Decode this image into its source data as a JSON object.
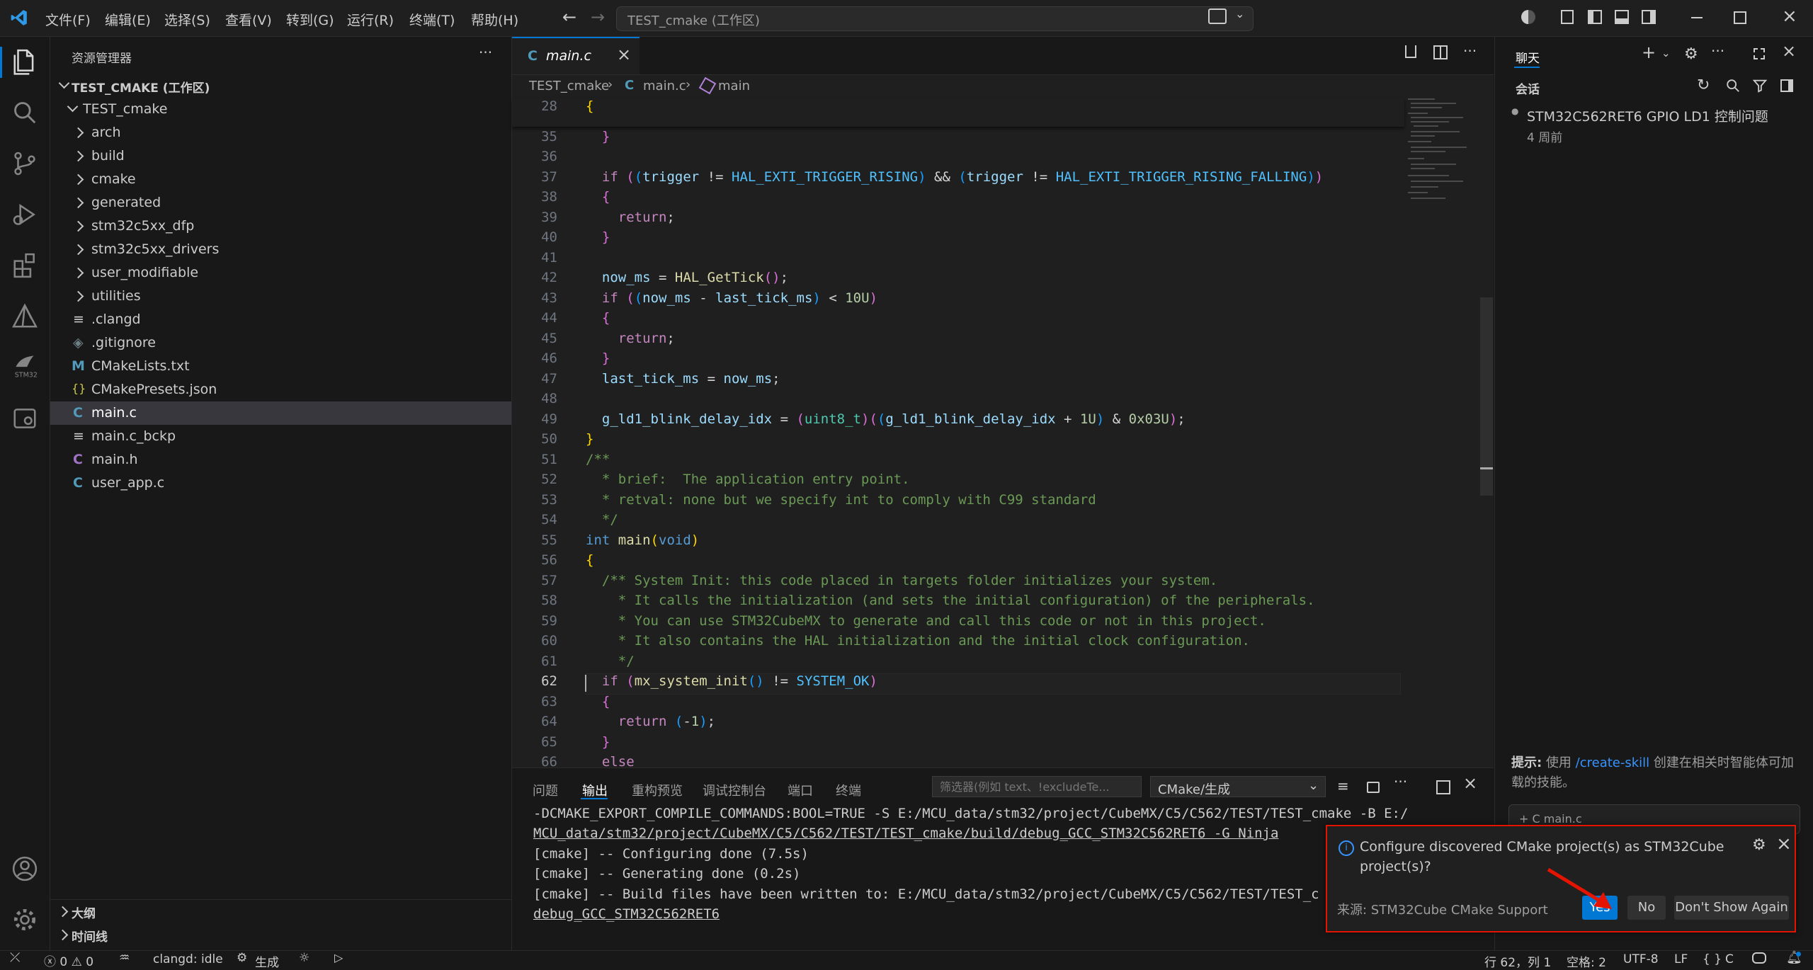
{
  "menu": [
    "文件(F)",
    "编辑(E)",
    "选择(S)",
    "查看(V)",
    "转到(G)",
    "运行(R)",
    "终端(T)",
    "帮助(H)"
  ],
  "command_center": "TEST_cmake (工作区)",
  "sidebar": {
    "title": "资源管理器",
    "workspace": "TEST_CMAKE (工作区)",
    "root_folder": "TEST_cmake",
    "folders": [
      "arch",
      "build",
      "cmake",
      "generated",
      "stm32c5xx_dfp",
      "stm32c5xx_drivers",
      "user_modifiable",
      "utilities"
    ],
    "files": [
      {
        "name": ".clangd",
        "icon": "≡",
        "color": "#cccccc"
      },
      {
        "name": ".gitignore",
        "icon": "◈",
        "color": "#6d8086"
      },
      {
        "name": "CMakeLists.txt",
        "icon": "M",
        "color": "#519aba"
      },
      {
        "name": "CMakePresets.json",
        "icon": "{}",
        "color": "#cbcb41"
      },
      {
        "name": "main.c",
        "icon": "C",
        "color": "#519aba"
      },
      {
        "name": "main.c_bckp",
        "icon": "≡",
        "color": "#cccccc"
      },
      {
        "name": "main.h",
        "icon": "C",
        "color": "#a074c4"
      },
      {
        "name": "user_app.c",
        "icon": "C",
        "color": "#519aba"
      }
    ],
    "outline": "大纲",
    "timeline": "时间线"
  },
  "editor": {
    "tab": "main.c",
    "breadcrumb": [
      "TEST_cmake",
      "main.c",
      "main"
    ],
    "sticky_line": "28",
    "line_numbers": [
      "35",
      "36",
      "37",
      "38",
      "39",
      "40",
      "41",
      "42",
      "43",
      "44",
      "45",
      "46",
      "47",
      "48",
      "49",
      "50",
      "51",
      "52",
      "53",
      "54",
      "55",
      "56",
      "57",
      "58",
      "59",
      "60",
      "61",
      "62",
      "63",
      "64",
      "65",
      "66"
    ]
  },
  "panel": {
    "tabs": [
      "问题",
      "输出",
      "重构预览",
      "调试控制台",
      "端口",
      "终端"
    ],
    "active_tab": "输出",
    "filter_placeholder": "筛选器(例如 text、!excludeTe...",
    "channel": "CMake/生成",
    "output_lines": [
      "-DCMAKE_EXPORT_COMPILE_COMMANDS:BOOL=TRUE -S E:/MCU_data/stm32/project/CubeMX/C5/C562/TEST/TEST_cmake -B E:/",
      "MCU_data/stm32/project/CubeMX/C5/C562/TEST/TEST_cmake/build/debug_GCC_STM32C562RET6 -G Ninja",
      "[cmake] -- Configuring done (7.5s)",
      "[cmake] -- Generating done (0.2s)",
      "[cmake] -- Build files have been written to: E:/MCU_data/stm32/project/CubeMX/C5/C562/TEST/TEST_c",
      "debug_GCC_STM32C562RET6"
    ]
  },
  "chat": {
    "title": "聊天",
    "section": "会话",
    "session_title": "STM32C562RET6 GPIO LD1 控制问题",
    "session_time": "4 周前",
    "tip_label": "提示:",
    "tip_text_1": " 使用 ",
    "tip_link": "/create-skill",
    "tip_text_2": " 创建在相关时智能体可加载的技能。",
    "input_fragment": "+ C main.c"
  },
  "notification": {
    "message_line1": "Configure discovered CMake project(s) as STM32Cube",
    "message_line2": "project(s)?",
    "source": "来源: STM32Cube CMake Support",
    "yes": "Yes",
    "no": "No",
    "dont_show": "Don't Show Again"
  },
  "status": {
    "errors": "0",
    "warnings": "0",
    "clangd": "clangd: idle",
    "build": "生成",
    "position": "行 62，列 1",
    "spaces": "空格: 2",
    "encoding": "UTF-8",
    "eol": "LF",
    "language": "C"
  },
  "colors": {
    "accent": "#0078d4",
    "notification_border": "#e51400",
    "button_primary": "#0078d4"
  }
}
